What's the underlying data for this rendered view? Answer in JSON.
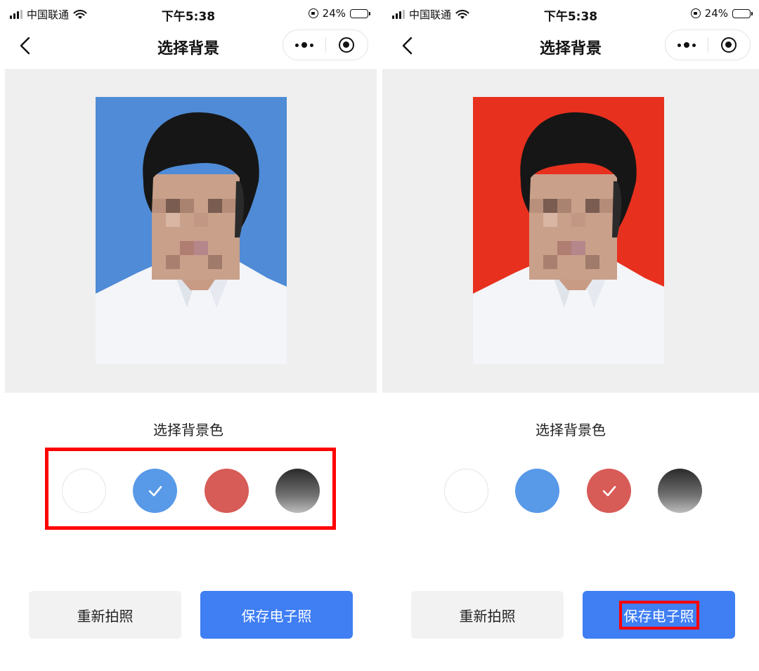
{
  "screens": [
    {
      "status": {
        "carrier": "中国联通",
        "time": "下午5:38",
        "battery": "24%"
      },
      "nav": {
        "title": "选择背景"
      },
      "preview": {
        "background_color": "#4f8bd6"
      },
      "picker": {
        "title": "选择背景色",
        "swatches": [
          {
            "color": "white",
            "selected": false
          },
          {
            "color": "blue",
            "selected": true
          },
          {
            "color": "red",
            "selected": false
          },
          {
            "color": "gradient-black",
            "selected": false
          }
        ]
      },
      "buttons": {
        "retake": "重新拍照",
        "save": "保存电子照"
      }
    },
    {
      "status": {
        "carrier": "中国联通",
        "time": "下午5:38",
        "battery": "24%"
      },
      "nav": {
        "title": "选择背景"
      },
      "preview": {
        "background_color": "#e8301f"
      },
      "picker": {
        "title": "选择背景色",
        "swatches": [
          {
            "color": "white",
            "selected": false
          },
          {
            "color": "blue",
            "selected": false
          },
          {
            "color": "red",
            "selected": true
          },
          {
            "color": "gradient-black",
            "selected": false
          }
        ]
      },
      "buttons": {
        "retake": "重新拍照",
        "save": "保存电子照"
      }
    }
  ]
}
